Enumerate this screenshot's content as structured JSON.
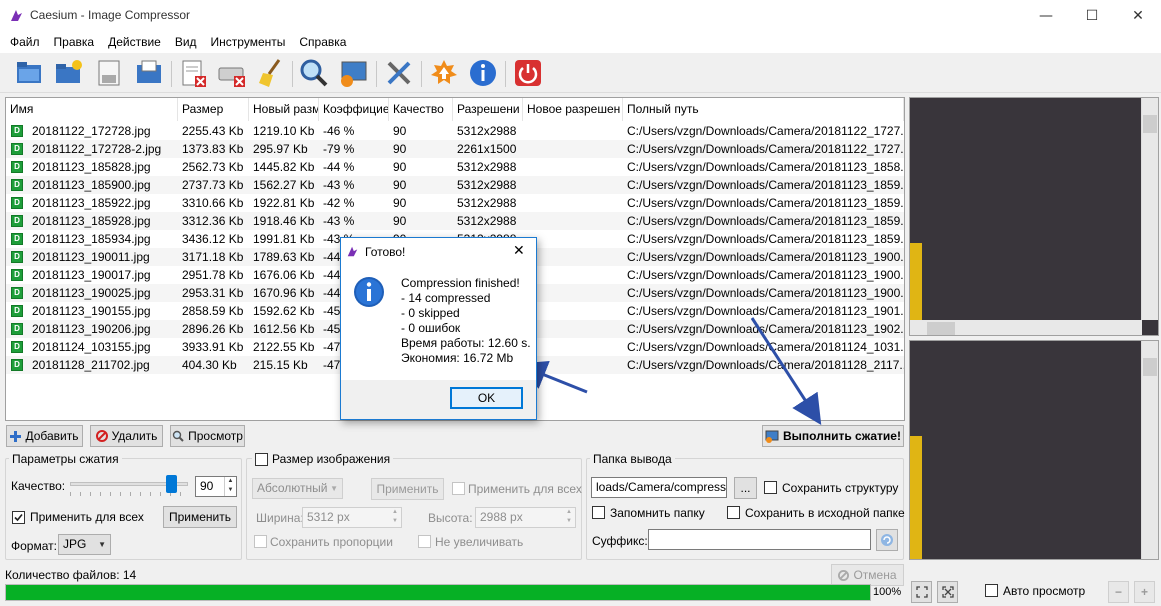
{
  "window": {
    "title": "Caesium - Image Compressor",
    "minimize": "—",
    "maximize": "☐",
    "close": "✕"
  },
  "menu": [
    "Файл",
    "Правка",
    "Действие",
    "Вид",
    "Инструменты",
    "Справка"
  ],
  "table": {
    "columns": [
      "Имя",
      "Размер",
      "Новый разм",
      "Коэффицие",
      "Качество",
      "Разрешени",
      "Новое разрешен",
      "Полный путь"
    ],
    "rows": [
      [
        "20181122_172728.jpg",
        "2255.43 Kb",
        "1219.10 Kb",
        "-46 %",
        "90",
        "5312x2988",
        "",
        "C:/Users/vzgn/Downloads/Camera/20181122_1727..."
      ],
      [
        "20181122_172728-2.jpg",
        "1373.83 Kb",
        "295.97 Kb",
        "-79 %",
        "90",
        "2261x1500",
        "",
        "C:/Users/vzgn/Downloads/Camera/20181122_1727..."
      ],
      [
        "20181123_185828.jpg",
        "2562.73 Kb",
        "1445.82 Kb",
        "-44 %",
        "90",
        "5312x2988",
        "",
        "C:/Users/vzgn/Downloads/Camera/20181123_1858..."
      ],
      [
        "20181123_185900.jpg",
        "2737.73 Kb",
        "1562.27 Kb",
        "-43 %",
        "90",
        "5312x2988",
        "",
        "C:/Users/vzgn/Downloads/Camera/20181123_1859..."
      ],
      [
        "20181123_185922.jpg",
        "3310.66 Kb",
        "1922.81 Kb",
        "-42 %",
        "90",
        "5312x2988",
        "",
        "C:/Users/vzgn/Downloads/Camera/20181123_1859..."
      ],
      [
        "20181123_185928.jpg",
        "3312.36 Kb",
        "1918.46 Kb",
        "-43 %",
        "90",
        "5312x2988",
        "",
        "C:/Users/vzgn/Downloads/Camera/20181123_1859..."
      ],
      [
        "20181123_185934.jpg",
        "3436.12 Kb",
        "1991.81 Kb",
        "-43 %",
        "90",
        "5312x2988",
        "",
        "C:/Users/vzgn/Downloads/Camera/20181123_1859..."
      ],
      [
        "20181123_190011.jpg",
        "3171.18 Kb",
        "1789.63 Kb",
        "-44 %",
        "90",
        "5312x2988",
        "",
        "C:/Users/vzgn/Downloads/Camera/20181123_1900..."
      ],
      [
        "20181123_190017.jpg",
        "2951.78 Kb",
        "1676.06 Kb",
        "-44 %",
        "90",
        "5312x2988",
        "",
        "C:/Users/vzgn/Downloads/Camera/20181123_1900..."
      ],
      [
        "20181123_190025.jpg",
        "2953.31 Kb",
        "1670.96 Kb",
        "-44 %",
        "90",
        "5312x2988",
        "",
        "C:/Users/vzgn/Downloads/Camera/20181123_1900..."
      ],
      [
        "20181123_190155.jpg",
        "2858.59 Kb",
        "1592.62 Kb",
        "-45 %",
        "90",
        "5312x2988",
        "",
        "C:/Users/vzgn/Downloads/Camera/20181123_1901..."
      ],
      [
        "20181123_190206.jpg",
        "2896.26 Kb",
        "1612.56 Kb",
        "-45 %",
        "90",
        "5312x2988",
        "",
        "C:/Users/vzgn/Downloads/Camera/20181123_1902..."
      ],
      [
        "20181124_103155.jpg",
        "3933.91 Kb",
        "2122.55 Kb",
        "-47 %",
        "90",
        "5312x2988",
        "",
        "C:/Users/vzgn/Downloads/Camera/20181124_1031..."
      ],
      [
        "20181128_211702.jpg",
        "404.30 Kb",
        "215.15 Kb",
        "-47 %",
        "90",
        "5312x2988",
        "",
        "C:/Users/vzgn/Downloads/Camera/20181128_2117..."
      ]
    ]
  },
  "actions": {
    "add": "Добавить",
    "remove": "Удалить",
    "view": "Просмотр",
    "compress": "Выполнить сжатие!"
  },
  "compression": {
    "group": "Параметры сжатия",
    "quality_label": "Качество:",
    "quality_value": "90",
    "apply_all_label": "Применить для всех",
    "apply_button": "Применить",
    "format_label": "Формат:",
    "format_value": "JPG"
  },
  "resize": {
    "group": "Размер изображения",
    "mode_value": "Абсолютный",
    "apply_button": "Применить",
    "apply_all_label": "Применить для всех",
    "width_label": "Ширина:",
    "width_value": "5312 px",
    "height_label": "Высота:",
    "height_value": "2988 px",
    "keep_ratio_label": "Сохранить пропорции",
    "no_enlarge_label": "Не увеличивать"
  },
  "output": {
    "group": "Папка вывода",
    "path_value": "loads/Camera/compressed",
    "browse_button": "...",
    "keep_structure_label": "Сохранить структуру",
    "remember_label": "Запомнить папку",
    "save_in_source_label": "Сохранить в исходной папке",
    "suffix_label": "Суффикс:",
    "suffix_value": ""
  },
  "status": {
    "file_count": "Количество файлов: 14",
    "cancel_button": "Отмена",
    "progress_text": "100%",
    "progress": 1.0
  },
  "preview": {
    "auto_label": "Авто просмотр"
  },
  "dialog": {
    "title": "Готово!",
    "lines": [
      "Compression finished!",
      "- 14 compressed",
      "- 0 skipped",
      "- 0 ошибок",
      "Время работы: 12.60 s.",
      "Экономия: 16.72 Mb"
    ],
    "ok": "OK"
  },
  "colors": {
    "accent": "#0078d7",
    "progress": "#06b025",
    "annotation_arrow": "#2d4fa8"
  }
}
